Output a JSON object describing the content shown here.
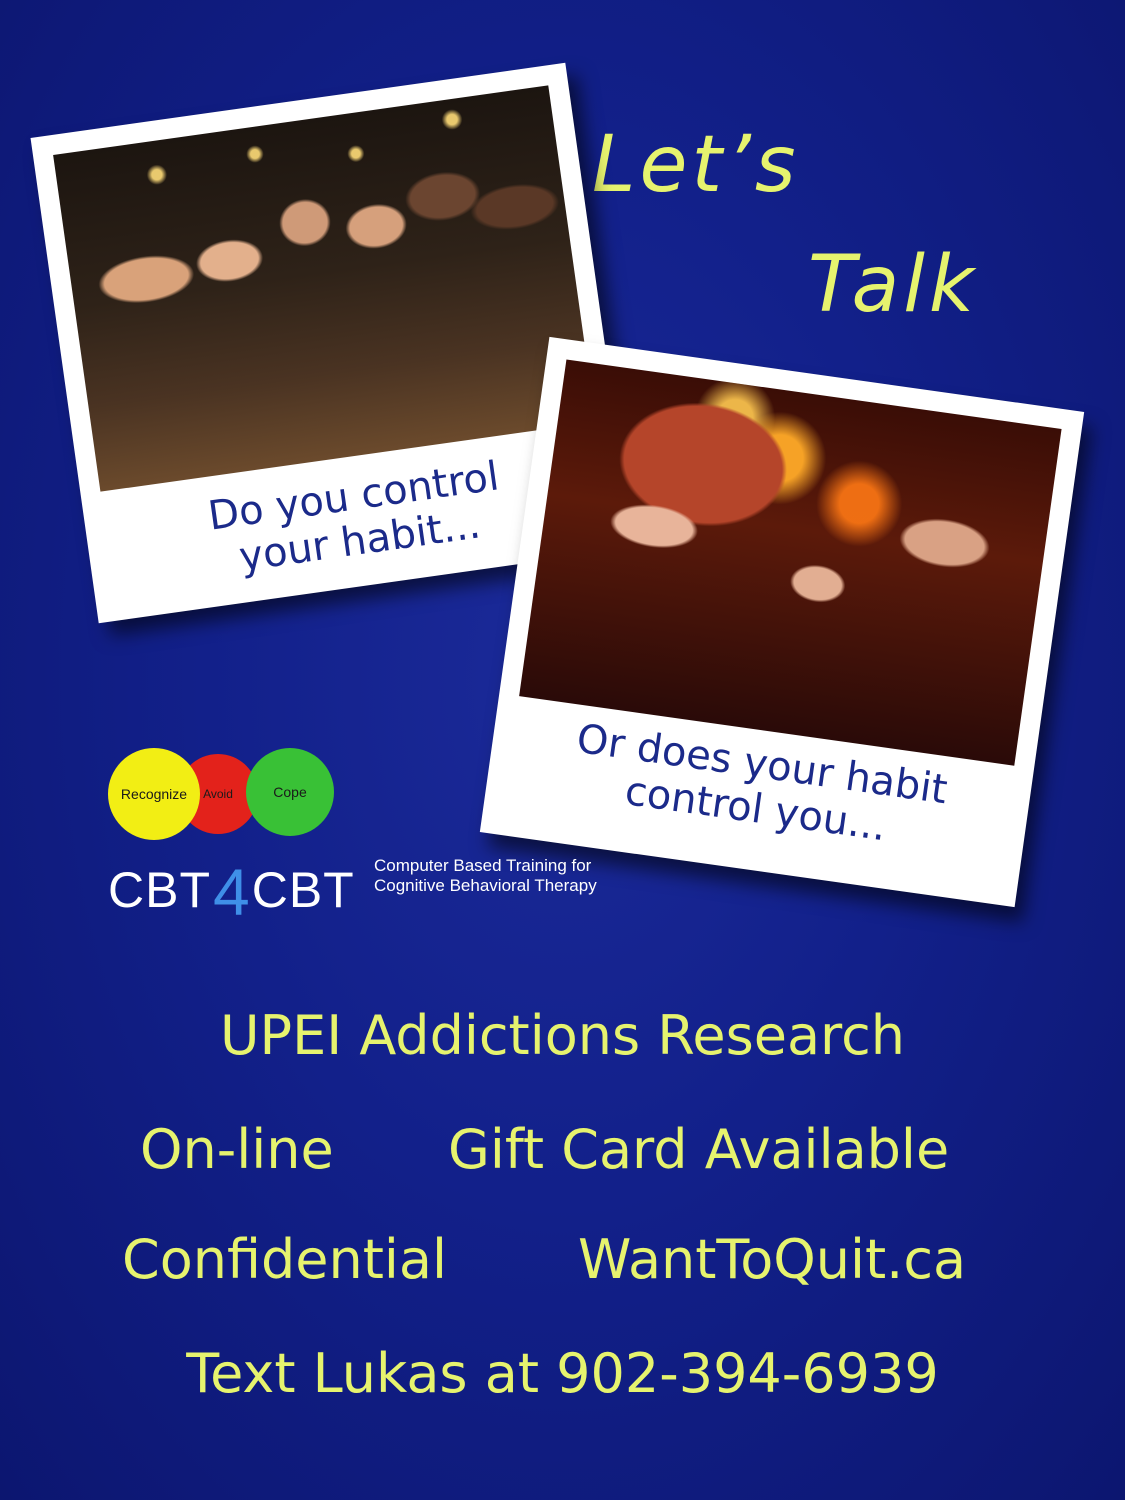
{
  "headline": {
    "line1": "Let’s",
    "line2": "Talk"
  },
  "photos": [
    {
      "caption_line1": "Do you control",
      "caption_line2": "your habit..."
    },
    {
      "caption_line1": "Or does your habit",
      "caption_line2": "control you..."
    }
  ],
  "logo": {
    "circles": [
      "Recognize",
      "Avoid",
      "Cope"
    ],
    "brand_left": "CBT",
    "brand_mid": "4",
    "brand_right": "CBT",
    "subtitle_line1": "Computer Based Training for",
    "subtitle_line2": "Cognitive Behavioral Therapy"
  },
  "info": {
    "title": "UPEI Addictions Research",
    "row2_left": "On-line",
    "row2_right": "Gift Card Available",
    "row3_left": "Confidential",
    "row3_right": "WantToQuit.ca",
    "contact": "Text Lukas at 902-394-6939"
  },
  "colors": {
    "background": "#12208a",
    "accent_text": "#e6f36e",
    "caption_text": "#1b2a8a",
    "logo_yellow": "#f2ee14",
    "logo_red": "#e3221b",
    "logo_green": "#39c136",
    "logo_blue": "#3f8fe8"
  }
}
